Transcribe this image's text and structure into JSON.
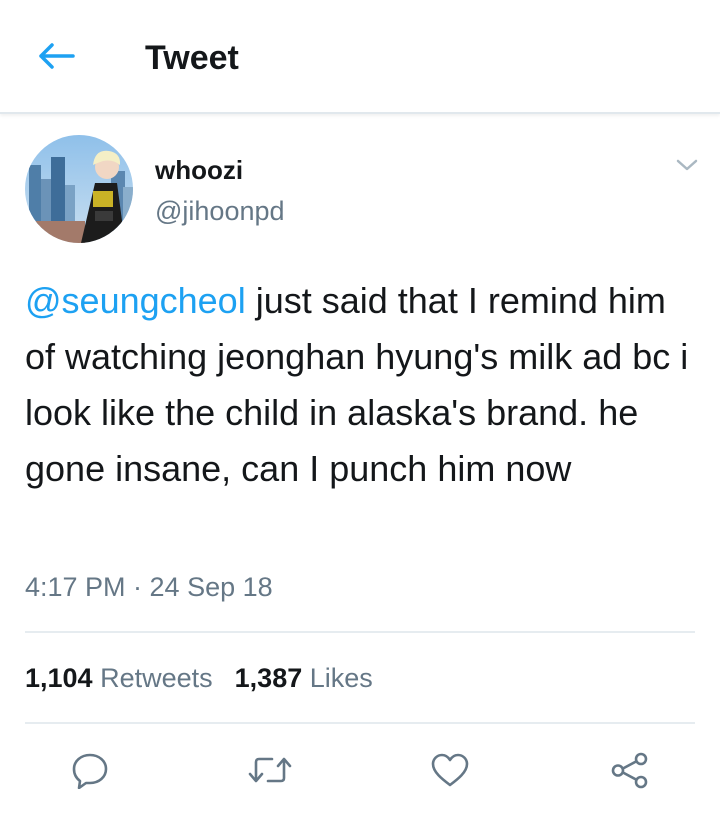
{
  "colors": {
    "accent": "#1da1f2",
    "text": "#14171a",
    "secondary": "#657786",
    "divider": "#e6ecf0"
  },
  "header": {
    "back_icon": "arrow-left-icon",
    "title": "Tweet"
  },
  "author": {
    "display_name": "whoozi",
    "handle": "@jihoonpd",
    "avatar": "profile-photo"
  },
  "menu_icon": "chevron-down-icon",
  "tweet": {
    "mention": "@seungcheol",
    "text": " just said that I remind him of watching jeonghan hyung's milk ad bc i look like the child in alaska's brand. he gone insane, can I punch him now",
    "timestamp": "4:17 PM · 24 Sep 18"
  },
  "stats": {
    "retweets_count": "1,104",
    "retweets_label": "Retweets",
    "likes_count": "1,387",
    "likes_label": "Likes"
  },
  "actions": [
    {
      "icon": "reply-icon"
    },
    {
      "icon": "retweet-icon"
    },
    {
      "icon": "heart-icon"
    },
    {
      "icon": "share-icon"
    }
  ]
}
